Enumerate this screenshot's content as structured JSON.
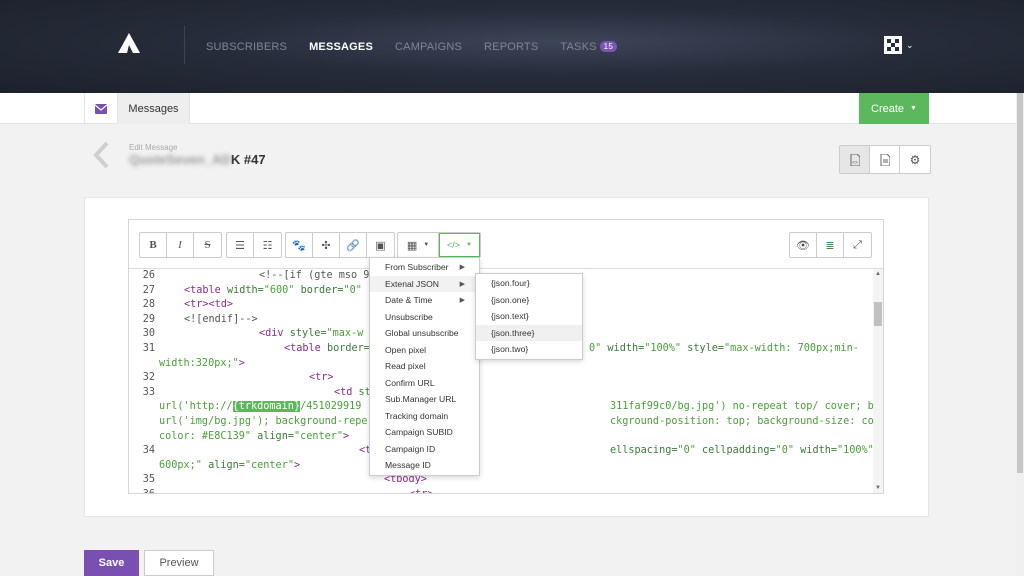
{
  "nav": {
    "items": [
      {
        "label": "SUBSCRIBERS"
      },
      {
        "label": "MESSAGES"
      },
      {
        "label": "CAMPAIGNS"
      },
      {
        "label": "REPORTS"
      },
      {
        "label": "TASKS",
        "badge": "15"
      }
    ]
  },
  "subbar": {
    "tab_label": "Messages",
    "create_label": "Create"
  },
  "header": {
    "edit_label": "Edit Message",
    "title_blurred": "QuoteSeven_AD",
    "title_suffix": "K #47"
  },
  "code": {
    "line_numbers": [
      "26",
      "27",
      "28",
      "29",
      "30",
      "31",
      "",
      "32",
      "33",
      "",
      "",
      "",
      "34",
      "",
      "35",
      "36"
    ],
    "highlight_token": "{trkdomain}"
  },
  "menu": {
    "items": [
      {
        "label": "From Subscriber",
        "submenu": true
      },
      {
        "label": "Extenal JSON",
        "submenu": true
      },
      {
        "label": "Date & Time",
        "submenu": true
      },
      {
        "label": "Unsubscribe"
      },
      {
        "label": "Global unsubscribe"
      },
      {
        "label": "Open pixel"
      },
      {
        "label": "Read pixel"
      },
      {
        "label": "Confirm URL"
      },
      {
        "label": "Sub.Manager URL"
      },
      {
        "label": "Tracking domain"
      },
      {
        "label": "Campaign SUBID"
      },
      {
        "label": "Campaign ID"
      },
      {
        "label": "Message ID"
      }
    ],
    "submenu_items": [
      {
        "label": "{json.four}"
      },
      {
        "label": "{json.one}"
      },
      {
        "label": "{json.text}"
      },
      {
        "label": "{json.three}"
      },
      {
        "label": "{json.two}"
      }
    ]
  },
  "footer": {
    "save_label": "Save",
    "preview_label": "Preview"
  },
  "colors": {
    "accent_purple": "#7a4fb2",
    "accent_green": "#5cb85c",
    "nav_bg": "#272c3a"
  }
}
